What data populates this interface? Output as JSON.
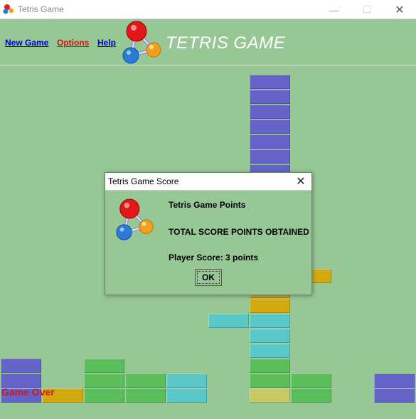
{
  "window": {
    "title": "Tetris Game",
    "minimize_glyph": "—",
    "maximize_glyph": "☐",
    "close_glyph": "✕"
  },
  "menu": {
    "items": [
      {
        "label": "New Game",
        "color": "#0000c8"
      },
      {
        "label": "Options",
        "color": "#d01010"
      },
      {
        "label": "Help",
        "color": "#0000c8"
      }
    ]
  },
  "heading": "TETRIS GAME",
  "status": "Game Over",
  "board": {
    "columns": 10,
    "rows": 22,
    "cell_colors": {
      "purple": "#6464c8",
      "gold": "#d2aa10",
      "green": "#5abe5a",
      "cyan": "#5ac8c8",
      "olive": "#c8c864"
    },
    "blocks": [
      {
        "col": 6,
        "row": 0,
        "color": "purple"
      },
      {
        "col": 6,
        "row": 1,
        "color": "purple"
      },
      {
        "col": 6,
        "row": 2,
        "color": "purple"
      },
      {
        "col": 6,
        "row": 3,
        "color": "purple"
      },
      {
        "col": 6,
        "row": 4,
        "color": "purple"
      },
      {
        "col": 6,
        "row": 5,
        "color": "purple"
      },
      {
        "col": 6,
        "row": 6,
        "color": "purple"
      },
      {
        "col": 6,
        "row": 7,
        "color": "purple"
      },
      {
        "col": 7,
        "row": 13,
        "color": "gold"
      },
      {
        "col": 6,
        "row": 14,
        "color": "gold"
      },
      {
        "col": 6,
        "row": 15,
        "color": "gold"
      },
      {
        "col": 5,
        "row": 16,
        "color": "cyan"
      },
      {
        "col": 6,
        "row": 16,
        "color": "cyan"
      },
      {
        "col": 6,
        "row": 17,
        "color": "cyan"
      },
      {
        "col": 6,
        "row": 18,
        "color": "cyan"
      },
      {
        "col": 0,
        "row": 19,
        "color": "purple"
      },
      {
        "col": 2,
        "row": 19,
        "color": "green"
      },
      {
        "col": 6,
        "row": 19,
        "color": "green"
      },
      {
        "col": 0,
        "row": 20,
        "color": "purple"
      },
      {
        "col": 2,
        "row": 20,
        "color": "green"
      },
      {
        "col": 3,
        "row": 20,
        "color": "green"
      },
      {
        "col": 4,
        "row": 20,
        "color": "cyan"
      },
      {
        "col": 6,
        "row": 20,
        "color": "green"
      },
      {
        "col": 7,
        "row": 20,
        "color": "green"
      },
      {
        "col": 9,
        "row": 20,
        "color": "purple"
      },
      {
        "col": 0,
        "row": 21,
        "color": "purple"
      },
      {
        "col": 1,
        "row": 21,
        "color": "gold"
      },
      {
        "col": 2,
        "row": 21,
        "color": "green"
      },
      {
        "col": 3,
        "row": 21,
        "color": "green"
      },
      {
        "col": 4,
        "row": 21,
        "color": "cyan"
      },
      {
        "col": 6,
        "row": 21,
        "color": "olive"
      },
      {
        "col": 7,
        "row": 21,
        "color": "green"
      },
      {
        "col": 9,
        "row": 21,
        "color": "purple"
      }
    ]
  },
  "dialog": {
    "title": "Tetris Game Score",
    "close_glyph": "✕",
    "line1": "Tetris Game Points",
    "line2": "TOTAL SCORE POINTS OBTAINED",
    "line3": "Player Score: 3 points",
    "ok_label": "OK"
  },
  "colors": {
    "background": "#98c796",
    "heading": "#ffffff",
    "game_over": "#d01818"
  },
  "icons": {
    "app": "molecule-icon",
    "logo": "molecule-logo-icon"
  }
}
